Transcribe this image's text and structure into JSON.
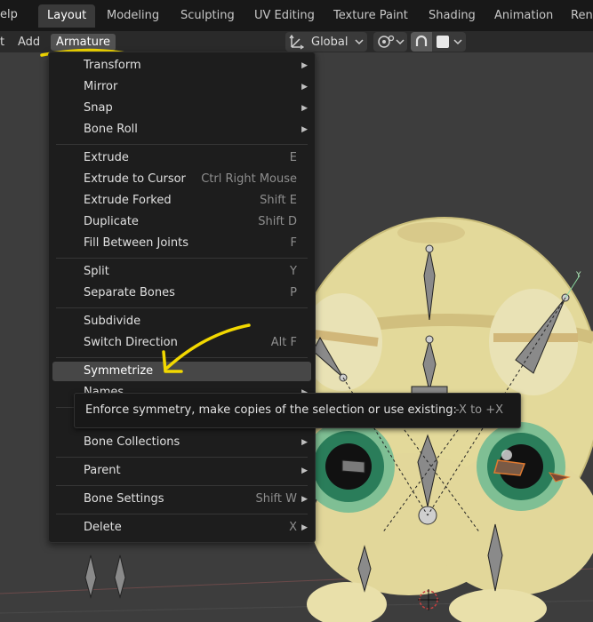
{
  "topbar": {
    "help_label": "elp",
    "tabs": [
      {
        "label": "Layout"
      },
      {
        "label": "Modeling"
      },
      {
        "label": "Sculpting"
      },
      {
        "label": "UV Editing"
      },
      {
        "label": "Texture Paint"
      },
      {
        "label": "Shading"
      },
      {
        "label": "Animation"
      },
      {
        "label": "Ren"
      }
    ]
  },
  "header": {
    "partial_label": "t",
    "add_label": "Add",
    "armature_label": "Armature",
    "orientation_value": "Global"
  },
  "menu": {
    "items": [
      {
        "label": "Transform",
        "shortcut": ""
      },
      {
        "label": "Mirror",
        "shortcut": ""
      },
      {
        "label": "Snap",
        "shortcut": ""
      },
      {
        "label": "Bone Roll",
        "shortcut": ""
      },
      {
        "label": "Extrude",
        "shortcut": "E"
      },
      {
        "label": "Extrude to Cursor",
        "shortcut": "Ctrl Right Mouse"
      },
      {
        "label": "Extrude Forked",
        "shortcut": "Shift E"
      },
      {
        "label": "Duplicate",
        "shortcut": "Shift D"
      },
      {
        "label": "Fill Between Joints",
        "shortcut": "F"
      },
      {
        "label": "Split",
        "shortcut": "Y"
      },
      {
        "label": "Separate Bones",
        "shortcut": "P"
      },
      {
        "label": "Subdivide",
        "shortcut": ""
      },
      {
        "label": "Switch Direction",
        "shortcut": "Alt F"
      },
      {
        "label": "Symmetrize",
        "shortcut": ""
      },
      {
        "label": "Names",
        "shortcut": ""
      },
      {
        "label": "Bone Collections",
        "shortcut": ""
      },
      {
        "label": "Parent",
        "shortcut": ""
      },
      {
        "label": "Bone Settings",
        "shortcut": "Shift W"
      },
      {
        "label": "Delete",
        "shortcut": "X"
      }
    ]
  },
  "tooltip": {
    "text": "Enforce symmetry, make copies of the selection or use existing:",
    "python": "-X to +X"
  },
  "colors": {
    "annotation": "#f2d800",
    "menu_bg": "#1d1d1d",
    "highlight": "#474747"
  }
}
